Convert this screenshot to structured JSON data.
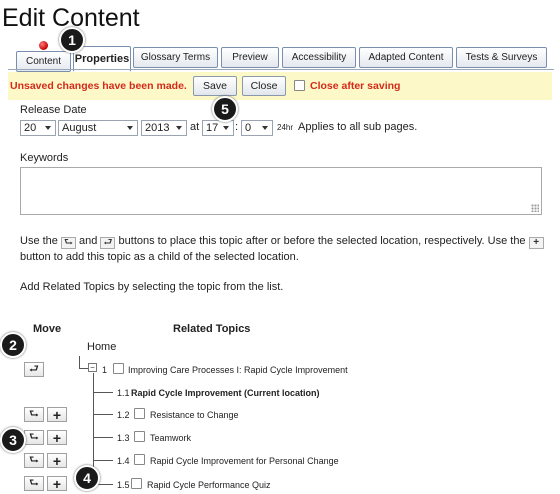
{
  "page": {
    "title": "Edit Content"
  },
  "tabs": [
    {
      "label": "Content"
    },
    {
      "label": "Properties"
    },
    {
      "label": "Glossary Terms"
    },
    {
      "label": "Preview"
    },
    {
      "label": "Accessibility"
    },
    {
      "label": "Adapted Content"
    },
    {
      "label": "Tests & Surveys"
    }
  ],
  "savebar": {
    "unsaved_text": "Unsaved changes have been made.",
    "save_label": "Save",
    "close_label": "Close",
    "close_after_saving_label": "Close after saving",
    "close_after_saving_checked": false
  },
  "release_date": {
    "label": "Release Date",
    "day": "20",
    "month": "August",
    "year": "2013",
    "at_label": "at",
    "hour": "17",
    "colon": ":",
    "minute": "0",
    "hr_label": "24hr",
    "applies_label": "Applies to all sub pages."
  },
  "keywords": {
    "label": "Keywords",
    "value": ""
  },
  "instructions": {
    "part1": "Use the",
    "part2": "and",
    "part3": "buttons to place this topic after or before the selected location, respectively. Use the",
    "part4": "button to add this topic as a child of the selected location.",
    "related_hint": "Add Related Topics by selecting the topic from the list."
  },
  "table": {
    "move_header": "Move",
    "related_header": "Related Topics"
  },
  "tree": {
    "home": "Home",
    "expander": "−",
    "items": [
      {
        "number": "1",
        "label": "Improving Care Processes I: Rapid Cycle Improvement"
      },
      {
        "number": "1.1",
        "label": "Rapid Cycle Improvement (Current location)"
      },
      {
        "number": "1.2",
        "label": "Resistance to Change"
      },
      {
        "number": "1.3",
        "label": "Teamwork"
      },
      {
        "number": "1.4",
        "label": "Rapid Cycle Improvement for Personal Change"
      },
      {
        "number": "1.5",
        "label": "Rapid Cycle Performance Quiz"
      }
    ]
  },
  "icons": {
    "after": "⮑",
    "before": "⮐",
    "add": "+"
  },
  "badges": [
    "1",
    "2",
    "3",
    "4",
    "5"
  ],
  "colors": {
    "warning_red": "#d42a1a",
    "savebar_bg": "#fcf8c7",
    "badge_bg": "#1a1a1a"
  }
}
